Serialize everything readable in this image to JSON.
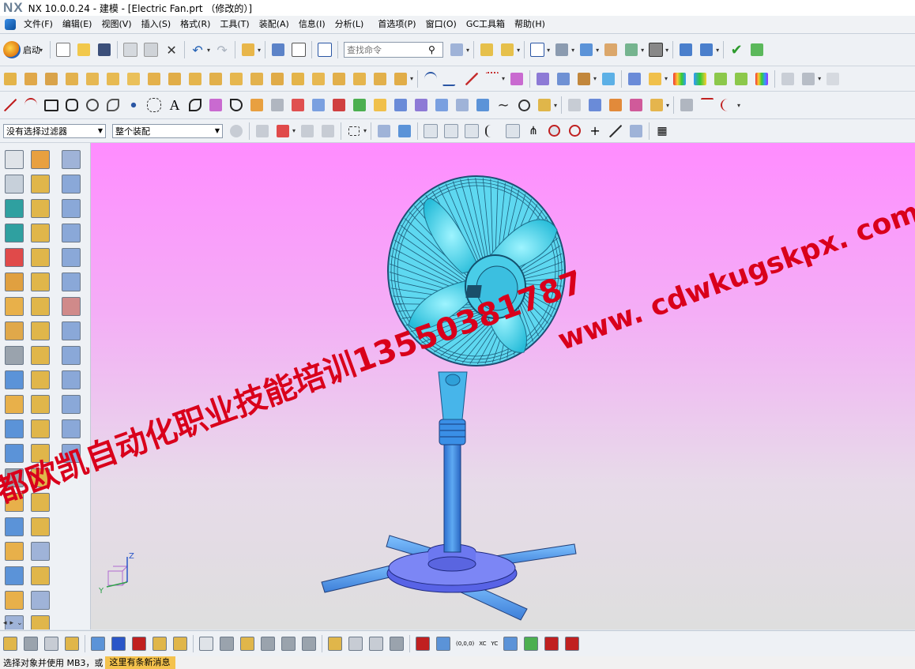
{
  "window": {
    "logo": "NX",
    "title": "NX 10.0.0.24 - 建模 - [Electric Fan.prt （修改的）]"
  },
  "menubar": {
    "items": [
      "文件(F)",
      "编辑(E)",
      "视图(V)",
      "插入(S)",
      "格式(R)",
      "工具(T)",
      "装配(A)",
      "信息(I)",
      "分析(L)",
      "首选项(P)",
      "窗口(O)",
      "GC工具箱",
      "帮助(H)"
    ]
  },
  "toolbar_main": {
    "start_label": "启动",
    "search_placeholder": "查找命令"
  },
  "selection_bar": {
    "filter_value": "没有选择过滤器",
    "scope_value": "整个装配"
  },
  "viewport": {
    "model_name": "Electric Fan",
    "watermark_url": "www. cdwkugskpx. com",
    "watermark_text": "都欧凯自动化职业技能培训13550381787",
    "triad": {
      "z": "Z",
      "y": "Y"
    }
  },
  "bottom_toolbar": {
    "csys_labels": [
      "(0,0,0)",
      "XC",
      "YC"
    ]
  },
  "status": {
    "message": "选择对象并使用 MB3，或",
    "notice": "这里有条新消息"
  },
  "colors": {
    "viewport_top": "#ff8cff",
    "viewport_bottom": "#dedede",
    "fan_blade": "#49d3ee",
    "fan_pole": "#3f8fe6",
    "fan_base": "#6c78f0",
    "watermark": "#d9001b"
  }
}
